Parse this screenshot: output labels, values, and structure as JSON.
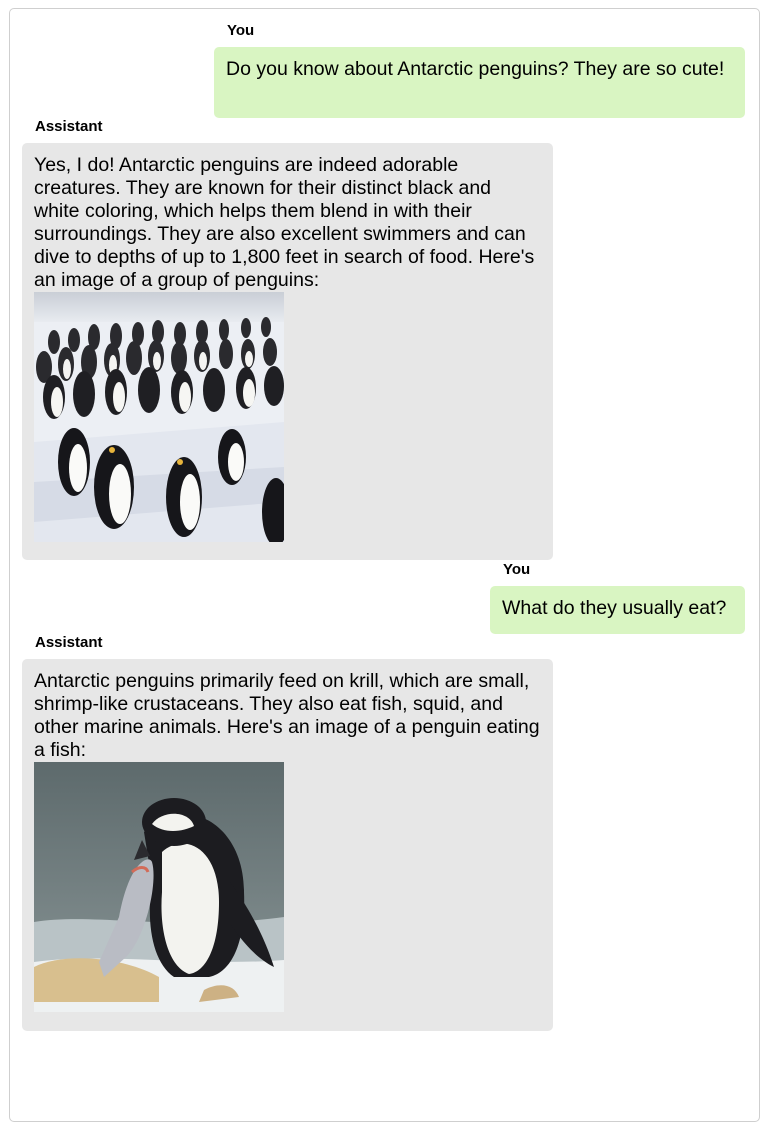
{
  "conversation": {
    "messages": [
      {
        "sender": "You",
        "text": "Do you know about Antarctic penguins? They are so cute!"
      },
      {
        "sender": "Assistant",
        "text": "Yes, I do! Antarctic penguins are indeed adorable creatures. They are known for their distinct black and white coloring, which helps them blend in with their surroundings. They are also excellent swimmers and can dive to depths of up to 1,800 feet in search of food. Here's an image of a group of penguins:"
      },
      {
        "sender": "You",
        "text": "What do they usually eat?"
      },
      {
        "sender": "Assistant",
        "text": "Antarctic penguins primarily feed on krill, which are small, shrimp-like crustaceans. They also eat fish, squid, and other marine animals. Here's an image of a penguin eating a fish:"
      }
    ]
  },
  "colors": {
    "user_bubble": "#d9f5c2",
    "assistant_bubble": "#e7e7e7",
    "border": "#cfcfcf"
  }
}
